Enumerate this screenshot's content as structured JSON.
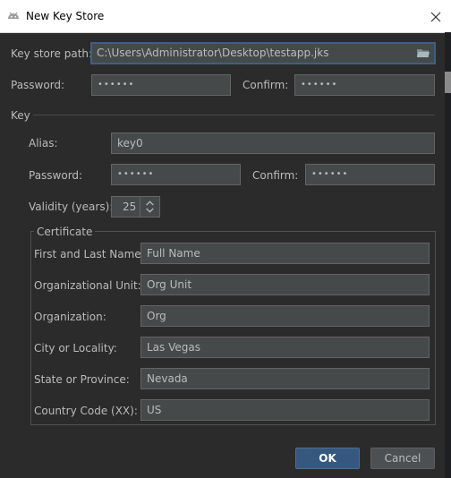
{
  "window": {
    "title": "New Key Store",
    "close_glyph": "✕"
  },
  "keystore": {
    "path_label": "Key store path:",
    "path_value": "C:\\Users\\Administrator\\Desktop\\testapp.jks",
    "password_label": "Password:",
    "password_value": "••••••",
    "confirm_label": "Confirm:",
    "confirm_value": "••••••"
  },
  "key": {
    "section_label": "Key",
    "alias_label": "Alias:",
    "alias_value": "key0",
    "password_label": "Password:",
    "password_value": "••••••",
    "confirm_label": "Confirm:",
    "confirm_value": "••••••",
    "validity_label": "Validity (years):",
    "validity_value": "25"
  },
  "certificate": {
    "title": "Certificate",
    "fields": [
      {
        "label": "First and Last Name:",
        "value": "Full Name"
      },
      {
        "label": "Organizational Unit:",
        "value": "Org Unit"
      },
      {
        "label": "Organization:",
        "value": "Org"
      },
      {
        "label": "City or Locality:",
        "value": "Las Vegas"
      },
      {
        "label": "State or Province:",
        "value": "Nevada"
      },
      {
        "label": "Country Code (XX):",
        "value": "US"
      }
    ]
  },
  "buttons": {
    "ok_label": "OK",
    "cancel_label": "Cancel"
  },
  "icons": {
    "app": "android-icon",
    "close": "close-icon",
    "browse": "folder-icon",
    "spinner": "up-down-arrows-icon"
  },
  "colors": {
    "background": "#2b2b2b",
    "field": "#45494a",
    "focus_border": "#3d6185",
    "primary_button": "#365880"
  }
}
